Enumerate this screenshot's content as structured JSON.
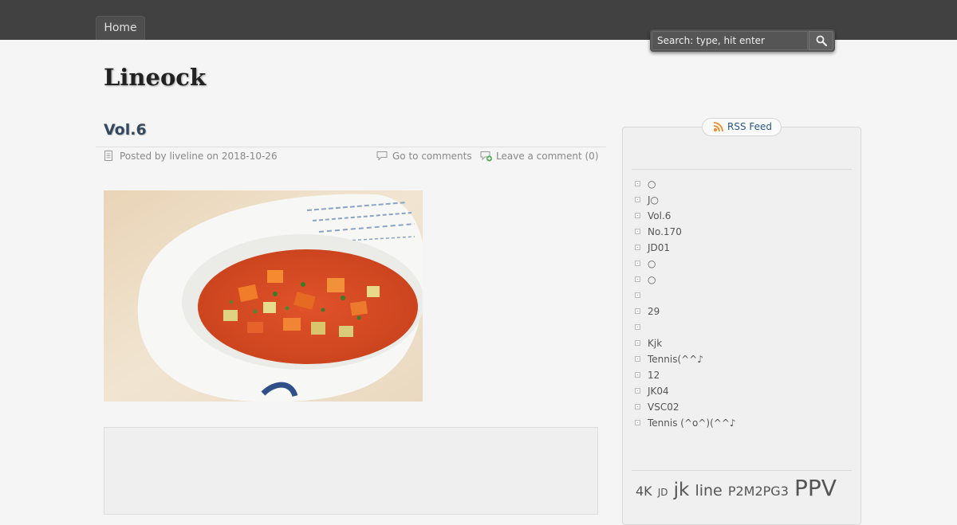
{
  "nav": {
    "home_label": "Home"
  },
  "search": {
    "placeholder": "Search: type, hit enter"
  },
  "site": {
    "title": "Lineock"
  },
  "post": {
    "title": "Vol.6",
    "posted_by": "Posted by liveline on 2018-10-26",
    "go_to_comments": "Go to comments",
    "leave_comment": "Leave a comment (0)"
  },
  "sidebar": {
    "rss_label": "RSS Feed",
    "items": [
      {
        "label": "○"
      },
      {
        "label": "J○"
      },
      {
        "label": "Vol.6"
      },
      {
        "label": " No.170"
      },
      {
        "label": "JD01"
      },
      {
        "label": "○"
      },
      {
        "label": "○"
      },
      {
        "label": ""
      },
      {
        "label": "29"
      },
      {
        "label": ""
      },
      {
        "label": "Kjk"
      },
      {
        "label": "Tennis(^^♪"
      },
      {
        "label": "12"
      },
      {
        "label": "JK04"
      },
      {
        "label": "VSC02"
      },
      {
        "label": "Tennis (^o^)(^^♪"
      }
    ],
    "tags": [
      {
        "label": "4K",
        "size": 16
      },
      {
        "label": "JD",
        "size": 12
      },
      {
        "label": "jk",
        "size": 23
      },
      {
        "label": "line",
        "size": 19
      },
      {
        "label": "P2M2PG3",
        "size": 16
      },
      {
        "label": "PPV",
        "size": 28
      }
    ]
  },
  "colors": {
    "topbar": "#414141",
    "background": "#f5f5f5",
    "post_title": "#34495e",
    "link": "#2a5a85"
  }
}
